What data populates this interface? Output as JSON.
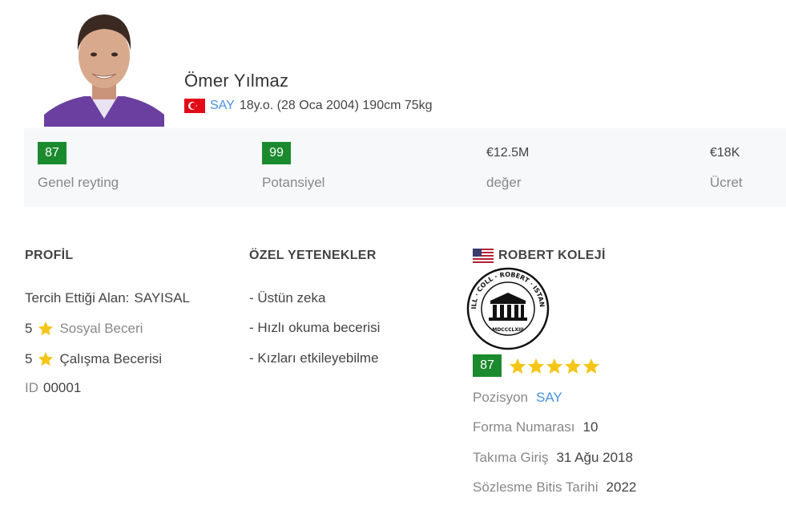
{
  "player": {
    "name": "Ömer Yılmaz",
    "position": "SAY",
    "details": "18y.o. (28 Oca 2004) 190cm 75kg"
  },
  "stats": [
    {
      "value": "87",
      "label": "Genel reyting",
      "badge": true
    },
    {
      "value": "99",
      "label": "Potansiyel",
      "badge": true
    },
    {
      "value": "€12.5M",
      "label": "değer",
      "badge": false
    },
    {
      "value": "€18K",
      "label": "Ücret",
      "badge": false
    }
  ],
  "profile": {
    "title": "PROFİL",
    "preferred_label": "Tercih Ettiği Alan:",
    "preferred_value": "SAYISAL",
    "social_num": "5",
    "social_label": "Sosyal Beceri",
    "work_num": "5",
    "work_label": "Çalışma Becerisi",
    "id_label": "ID",
    "id_value": "00001"
  },
  "skills": {
    "title": "ÖZEL YETENEKLER",
    "items": [
      "- Üstün zeka",
      "- Hızlı okuma becerisi",
      "- Kızları etkileyebilme"
    ]
  },
  "school": {
    "title": "ROBERT KOLEJİ",
    "logo_text": "SIGILL · COLL · ROBERT · ISTANBUL",
    "logo_numeral": "MDCCCLXIII",
    "rating": "87",
    "stars": 5,
    "position_label": "Pozisyon",
    "position_value": "SAY",
    "number_label": "Forma Numarası",
    "number_value": "10",
    "join_label": "Takıma Giriş",
    "join_value": "31 Ağu 2018",
    "contract_label": "Sözlesme Bitis Tarihi",
    "contract_value": "2022"
  },
  "colors": {
    "badge_green": "#1b8a2e",
    "link_blue": "#4a90e2",
    "star_gold": "#f5c518"
  }
}
